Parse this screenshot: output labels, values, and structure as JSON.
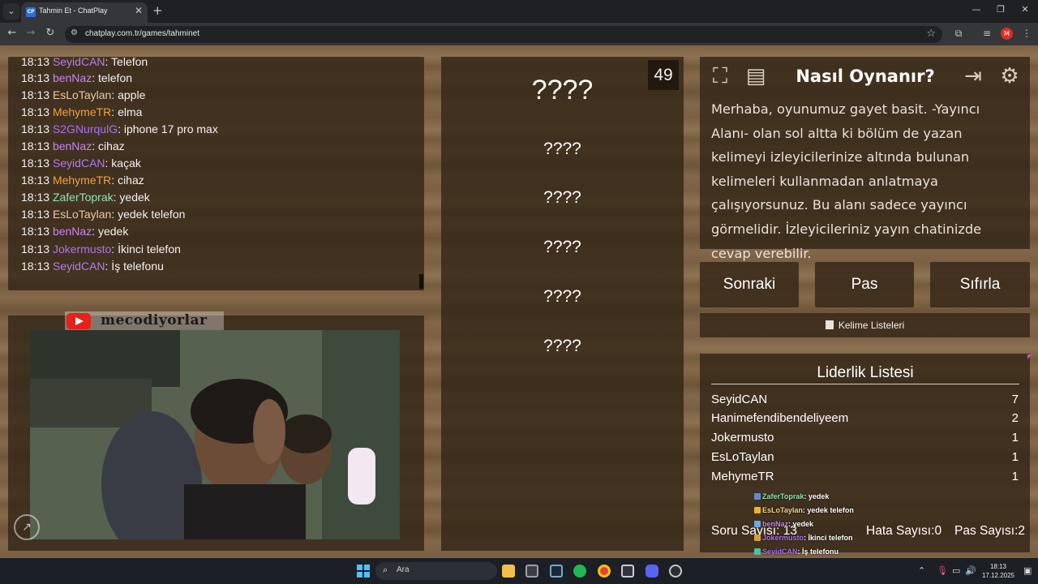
{
  "browser": {
    "tab_title": "Tahmin Et - ChatPlay",
    "tab_favicon": "CP",
    "url": "chatplay.com.tr/games/tahminet",
    "profile_initial": "M"
  },
  "chat": {
    "messages": [
      {
        "time": "18:13",
        "user": "SeyidCAN",
        "color": "#b27cf2",
        "text": ": Telefon"
      },
      {
        "time": "18:13",
        "user": "benNaz",
        "color": "#c584f0",
        "text": ": telefon"
      },
      {
        "time": "18:13",
        "user": "EsLoTaylan",
        "color": "#e8c9a8",
        "text": ": apple"
      },
      {
        "time": "18:13",
        "user": "MehymeTR",
        "color": "#f0a23a",
        "text": ": elma"
      },
      {
        "time": "18:13",
        "user": "S2GNurqulG",
        "color": "#a96ef5",
        "text": ": iphone 17 pro max"
      },
      {
        "time": "18:13",
        "user": "benNaz",
        "color": "#c584f0",
        "text": ": cihaz"
      },
      {
        "time": "18:13",
        "user": "SeyidCAN",
        "color": "#b27cf2",
        "text": ": kaçak"
      },
      {
        "time": "18:13",
        "user": "MehymeTR",
        "color": "#f0a23a",
        "text": ": cihaz"
      },
      {
        "time": "18:13",
        "user": "ZaferToprak",
        "color": "#8fe3b0",
        "text": ": yedek"
      },
      {
        "time": "18:13",
        "user": "EsLoTaylan",
        "color": "#e8c9a8",
        "text": ": yedek telefon"
      },
      {
        "time": "18:13",
        "user": "benNaz",
        "color": "#c584f0",
        "text": ": yedek"
      },
      {
        "time": "18:13",
        "user": "Jokermusto",
        "color": "#b070f0",
        "text": ": İkinci telefon"
      },
      {
        "time": "18:13",
        "user": "SeyidCAN",
        "color": "#b27cf2",
        "text": ": İş telefonu"
      }
    ]
  },
  "streamer": {
    "channel_name": "mecodiyorlar"
  },
  "game": {
    "countdown": "49",
    "main_word": "????",
    "forbidden_words": [
      "????",
      "????",
      "????",
      "????",
      "????"
    ]
  },
  "howto": {
    "title": "Nasıl Oynanır?",
    "text": "Merhaba, oyunumuz gayet basit. -Yayıncı Alanı- olan sol altta ki bölüm de yazan kelimeyi izleyicilerinize altında bulunan kelimeleri kullanmadan anlatmaya çalışıyorsunuz. Bu alanı sadece yayıncı görmelidir. İzleyicileriniz yayın chatinizde cevap verebilir."
  },
  "actions": {
    "next": "Sonraki",
    "pass": "Pas",
    "reset": "Sıfırla",
    "word_lists": "Kelime Listeleri"
  },
  "leaderboard": {
    "title": "Liderlik Listesi",
    "rows": [
      {
        "name": "SeyidCAN",
        "score": "7"
      },
      {
        "name": "Hanimefendibendeliyeem",
        "score": "2"
      },
      {
        "name": "Jokermusto",
        "score": "1"
      },
      {
        "name": "EsLoTaylan",
        "score": "1"
      },
      {
        "name": "MehymeTR",
        "score": "1"
      }
    ]
  },
  "stats": {
    "question_label": "Soru Sayısı:",
    "question_value": "13",
    "error_label": "Hata Sayısı:",
    "error_value": "0",
    "pass_label": "Pas Sayısı:",
    "pass_value": "2"
  },
  "chat_overlay": [
    {
      "user": "ZaferToprak",
      "color": "#8fe3b0",
      "text": ": yedek"
    },
    {
      "user": "EsLoTaylan",
      "color": "#f0d890",
      "text": ": yedek telefon"
    },
    {
      "user": "benNaz",
      "color": "#c584f0",
      "text": ": yedek"
    },
    {
      "user": "Jokermusto",
      "color": "#b070f0",
      "text": ": İkinci telefon"
    },
    {
      "user": "SeyidCAN",
      "color": "#a96ef5",
      "text": ": İş telefonu"
    }
  ],
  "taskbar": {
    "search_placeholder": "Ara",
    "time": "18:13",
    "date": "17.12.2025"
  }
}
